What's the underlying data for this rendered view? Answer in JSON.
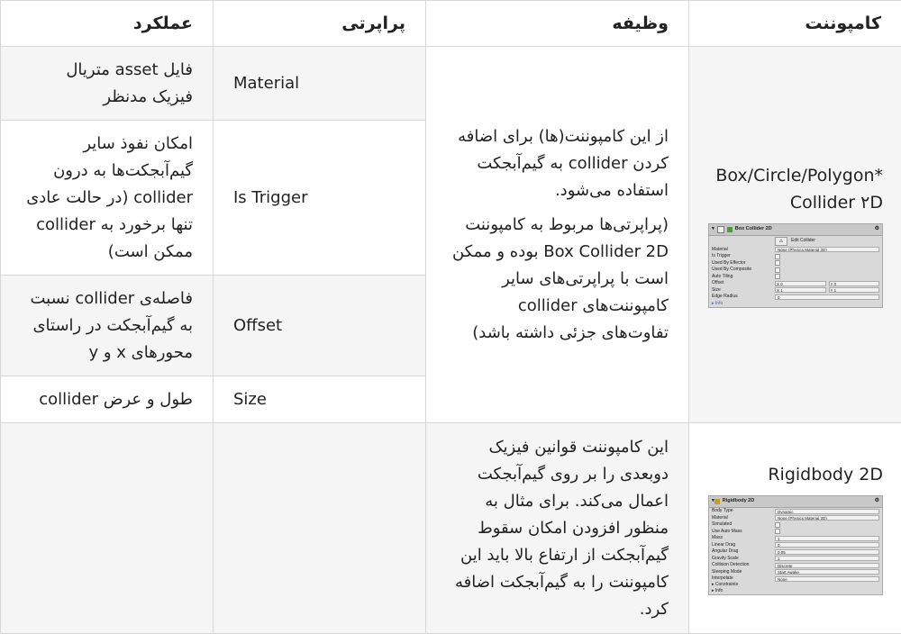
{
  "headers": {
    "component": "کامپوننت",
    "function": "وظیفه",
    "property": "پراپرتی",
    "action": "عملکرد"
  },
  "row1": {
    "component_name": "Box/Circle/Polygon*\nCollider ۲D",
    "function_p1": "از این کامپوننت(ها) برای اضافه کردن collider به گیم‌آبجکت استفاده می‌شود.",
    "function_p2": "(پراپرتی‌ها مربوط به کامپوننت Box Collider 2D بوده و ممکن است با پراپرتی‌های سایر کامپوننت‌های collider تفاوت‌های جزئی داشته باشد)",
    "properties": [
      {
        "name": "Material",
        "action": "فایل asset متریال فیزیک مدنظر"
      },
      {
        "name": "Is Trigger",
        "action": "امکان نفوذ سایر گیم‌آبجکت‌ها به درون collider (در حالت عادی تنها برخورد به collider ممکن است)"
      },
      {
        "name": "Offset",
        "action": "فاصله‌ی collider نسبت به گیم‌آبجکت در راستای محورهای x و y"
      },
      {
        "name": "Size",
        "action": "طول و عرض collider"
      }
    ],
    "inspector": {
      "title": "Box Collider 2D",
      "edit_label": "Edit Collider",
      "rows": [
        {
          "label": "Material",
          "value": "None (Physics Material 2D)"
        },
        {
          "label": "Is Trigger",
          "value": ""
        },
        {
          "label": "Used By Effector",
          "value": ""
        },
        {
          "label": "Used By Composite",
          "value": ""
        },
        {
          "label": "Auto Tiling",
          "value": ""
        },
        {
          "label": "Offset",
          "x": "X  0",
          "y": "Y  0"
        },
        {
          "label": "Size",
          "x": "X  1",
          "y": "Y  1"
        },
        {
          "label": "Edge Radius",
          "value": "0"
        }
      ],
      "info": "Info"
    }
  },
  "row2": {
    "component_name": "Rigidbody 2D",
    "function_text": "این کامپوننت قوانین فیزیک دوبعدی را بر روی گیم‌آبجکت اعمال می‌کند. برای مثال به منظور افزودن امکان سقوط گیم‌آبجکت از ارتفاع بالا باید این کامپوننت را به گیم‌آبجکت اضافه کرد.",
    "property": "",
    "action": "",
    "inspector": {
      "title": "Rigidbody 2D",
      "rows": [
        {
          "label": "Body Type",
          "value": "Dynamic"
        },
        {
          "label": "Material",
          "value": "None (Physics Material 2D)"
        },
        {
          "label": "Simulated",
          "value": ""
        },
        {
          "label": "Use Auto Mass",
          "value": ""
        },
        {
          "label": "Mass",
          "value": "1"
        },
        {
          "label": "Linear Drag",
          "value": "0"
        },
        {
          "label": "Angular Drag",
          "value": "0.05"
        },
        {
          "label": "Gravity Scale",
          "value": "1"
        },
        {
          "label": "Collision Detection",
          "value": "Discrete"
        },
        {
          "label": "Sleeping Mode",
          "value": "Start Awake"
        },
        {
          "label": "Interpolate",
          "value": "None"
        }
      ],
      "constraints": "Constraints",
      "info": "Info"
    }
  }
}
